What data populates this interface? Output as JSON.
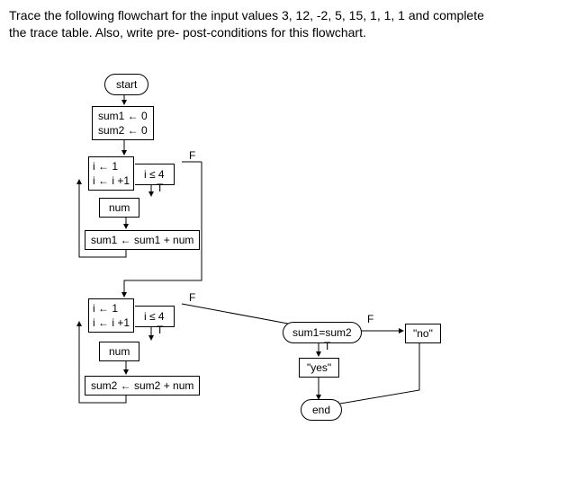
{
  "instructions": {
    "line1": "Trace the following flowchart for the input values 3, 12, -2, 5, 15, 1, 1, 1 and complete",
    "line2": "the trace table. Also, write pre- post-conditions for this flowchart."
  },
  "nodes": {
    "start": "start",
    "init1": "sum1 ← 0",
    "init2": "sum2 ← 0",
    "loop1_init": "i ← 1",
    "loop1_inc": "i ← i +1",
    "loop1_cond": "i ≤ 4",
    "read1": "num",
    "accum1": "sum1 ← sum1 + num",
    "loop2_init": "i ← 1",
    "loop2_inc": "i ← i +1",
    "loop2_cond": "i ≤ 4",
    "read2": "num",
    "accum2": "sum2 ← sum2 + num",
    "compare": "sum1=sum2",
    "outYes": "\"yes\"",
    "outNo": "\"no\"",
    "end": "end"
  },
  "labels": {
    "T": "T",
    "F": "F"
  }
}
